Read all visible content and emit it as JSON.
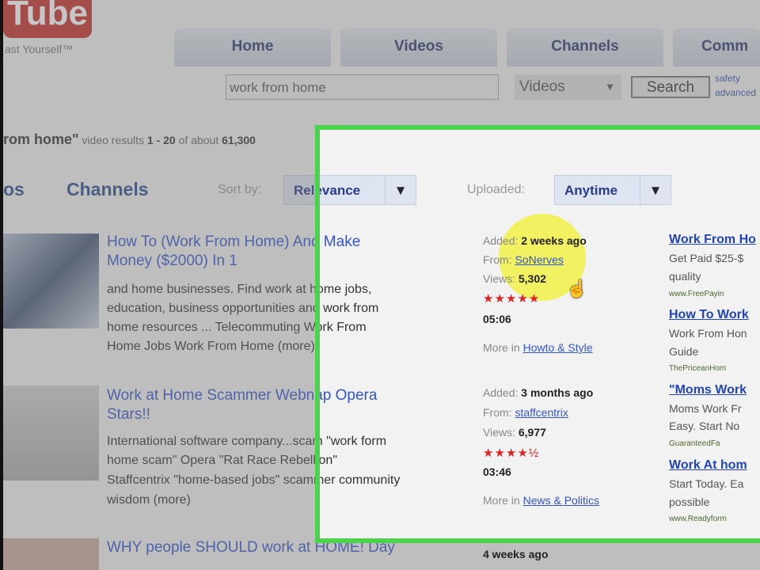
{
  "header": {
    "logo": "Tube",
    "slogan": "ast Yourself™",
    "nav": [
      "Home",
      "Videos",
      "Channels",
      "Comm"
    ],
    "search_value": "work from home",
    "search_type": "Videos",
    "search_button": "Search",
    "links": [
      "safety",
      "advanced"
    ]
  },
  "summary": {
    "query": "rom home\"",
    "text": " video results ",
    "range": "1 - 20",
    "of": " of about ",
    "total": "61,300"
  },
  "filters": {
    "tab_videos": "os",
    "tab_channels": "Channels",
    "sort_label": "Sort by:",
    "sort_value": "Relevance",
    "uploaded_label": "Uploaded:",
    "uploaded_value": "Anytime"
  },
  "results": [
    {
      "title": [
        "How To (Work From Home) And Make",
        "Money ($2000) In 1"
      ],
      "desc": [
        "and home businesses. Find work at home jobs,",
        "education, business opportunities and work from",
        "home resources ... Telecommuting Work From",
        "Home Jobs Work From Home (more)"
      ],
      "added_label": "Added:",
      "added": "2 weeks ago",
      "from_label": "From:",
      "from": "SoNerves",
      "views_label": "Views:",
      "views": "5,302",
      "stars": "★★★★★",
      "duration": "05:06",
      "more_label": "More in",
      "category": "Howto & Style"
    },
    {
      "title": [
        "Work at Home Scammer Webnap Opera",
        "Stars!!"
      ],
      "desc": [
        "International software company...scam \"work form",
        "home scam\" Opera \"Rat Race Rebellion\"",
        "Staffcentrix \"home-based jobs\" scammer community",
        "wisdom (more)"
      ],
      "added_label": "Added:",
      "added": "3 months ago",
      "from_label": "From:",
      "from": "staffcentrix",
      "views_label": "Views:",
      "views": "6,977",
      "stars": "★★★★½",
      "duration": "03:46",
      "more_label": "More in",
      "category": "News & Politics"
    },
    {
      "title": [
        "WHY people SHOULD work at HOME! Day"
      ],
      "added": "4 weeks ago"
    }
  ],
  "sponsored": [
    {
      "title": "Work From Ho",
      "lines": [
        "Get Paid $25-$",
        "quality"
      ],
      "url": "www.FreePayin"
    },
    {
      "title": "How To Work",
      "lines": [
        "Work From Hon",
        "Guide"
      ],
      "url": "ThePriceanHom"
    },
    {
      "title": "\"Moms Work",
      "lines": [
        "Moms Work Fr",
        "Easy. Start No"
      ],
      "url": "GuaranteedFa"
    },
    {
      "title": "Work At hom",
      "lines": [
        "Start Today. Ea",
        "possible"
      ],
      "url": "www.Readyform"
    }
  ],
  "colors": {
    "highlight_box": "#4cd24c",
    "cursor_spot": "#f0f000"
  }
}
